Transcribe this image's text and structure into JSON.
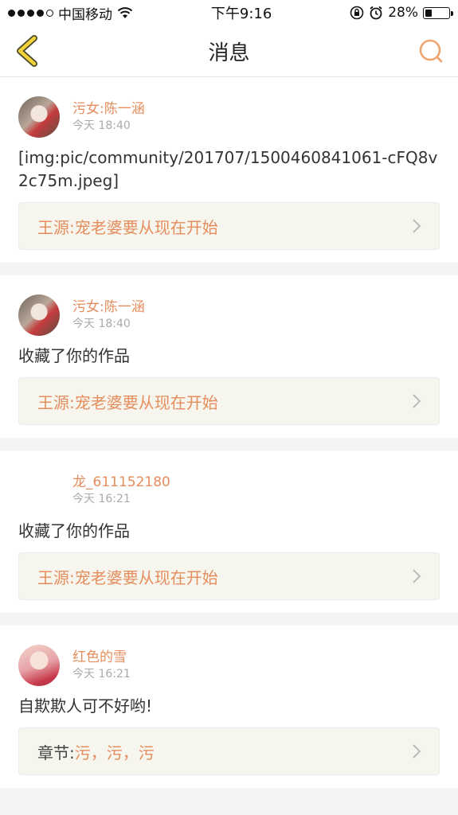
{
  "statusbar": {
    "carrier": "中国移动",
    "time": "下午9:16",
    "battery": "28%",
    "battery_level": 0.28
  },
  "navbar": {
    "title": "消息"
  },
  "messages": [
    {
      "user": "污女:陈一涵",
      "time": "今天 18:40",
      "content": "[img:pic/community/201707/1500460841061-cFQ8v2c75m.jpeg]",
      "ref_prefix": "",
      "ref": "王源:宠老婆要从现在开始"
    },
    {
      "user": "污女:陈一涵",
      "time": "今天 18:40",
      "content": "收藏了你的作品",
      "ref_prefix": "",
      "ref": "王源:宠老婆要从现在开始"
    },
    {
      "user": "龙_611152180",
      "time": "今天 16:21",
      "content": "收藏了你的作品",
      "ref_prefix": "",
      "ref": "王源:宠老婆要从现在开始"
    },
    {
      "user": "红色的雪",
      "time": "今天 16:21",
      "content": "自欺欺人可不好哟!",
      "ref_prefix": "章节:",
      "ref": "污，污，污"
    }
  ]
}
